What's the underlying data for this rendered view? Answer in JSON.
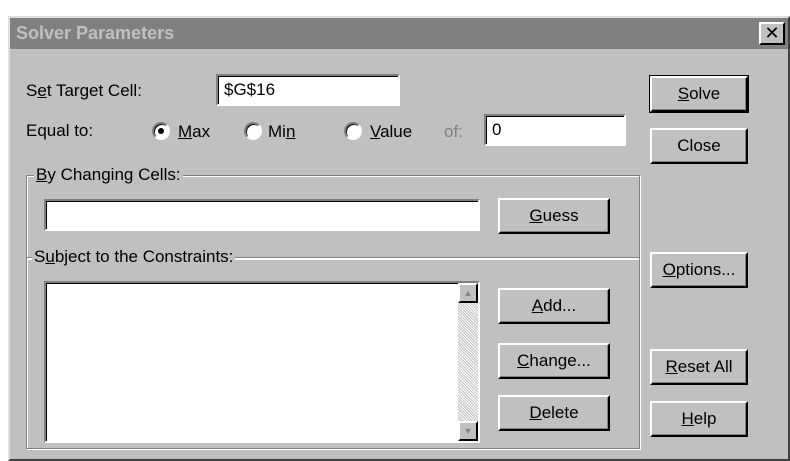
{
  "title": "Solver Parameters",
  "close_glyph": "✕",
  "target": {
    "label_pre": "S",
    "label_u": "e",
    "label_post": "t Target Cell:",
    "value": "$G$16"
  },
  "equal_to": {
    "label": "Equal to:",
    "max": {
      "u": "M",
      "rest": "ax",
      "selected": true
    },
    "min": {
      "pre": "Mi",
      "u": "n",
      "selected": false
    },
    "value": {
      "u": "V",
      "rest": "alue",
      "selected": false
    },
    "of_label": "of:",
    "of_value": "0"
  },
  "changing": {
    "label_u": "B",
    "label_rest": "y Changing Cells:",
    "value": ""
  },
  "constraints": {
    "label_pre": "S",
    "label_u": "u",
    "label_rest": "bject to the Constraints:",
    "items": []
  },
  "buttons": {
    "solve": {
      "u": "S",
      "rest": "olve"
    },
    "close": "Close",
    "guess": {
      "u": "G",
      "rest": "uess"
    },
    "options": {
      "u": "O",
      "rest": "ptions..."
    },
    "add": {
      "u": "A",
      "rest": "dd..."
    },
    "change": {
      "u": "C",
      "rest": "hange..."
    },
    "delete": {
      "u": "D",
      "rest": "elete"
    },
    "reset": {
      "u": "R",
      "rest": "eset All"
    },
    "help": {
      "u": "H",
      "rest": "elp"
    }
  },
  "icons": {
    "scroll_up": "▲",
    "scroll_down": "▼"
  },
  "colors": {
    "face": "#c0c0c0",
    "title_bar": "#808080",
    "title_text": "#c0c0c0"
  }
}
